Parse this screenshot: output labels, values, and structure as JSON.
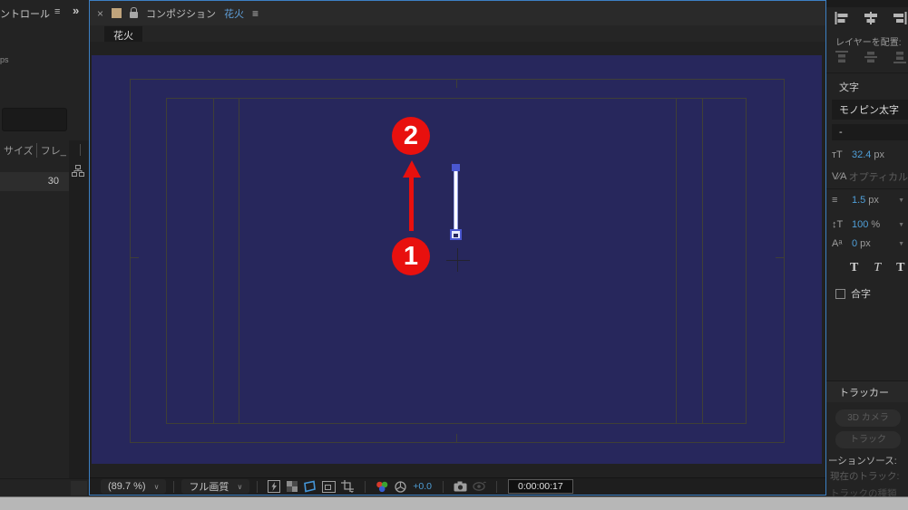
{
  "colors": {
    "accent_blue": "#3c80c4",
    "value_blue": "#4f9fd8",
    "comp_background": "#27275c",
    "annotation_red": "#e8100e",
    "panel_background": "#232323"
  },
  "left_panel": {
    "tab_label": "ントロール",
    "panel_menu_icon": "≡",
    "expand_icon": "»",
    "info_text": "ps",
    "table": {
      "columns": [
        "サイズ",
        "フレ_"
      ],
      "row_value": "30"
    }
  },
  "comp_panel": {
    "close_label": "×",
    "panel_title": "コンポジション",
    "comp_name": "花火",
    "panel_menu_icon": "≡",
    "tab_label": "花火",
    "annotations": {
      "step_1": "1",
      "step_2": "2"
    },
    "toolbar": {
      "zoom_value": "(89.7 %)",
      "zoom_chevron": "∨",
      "quality_value": "フル画質",
      "quality_chevron": "∨",
      "exposure_value": "+0.0",
      "timecode": "0:00:00:17"
    }
  },
  "right_panel": {
    "align": {
      "label": "レイヤーを配置:"
    },
    "character": {
      "header": "文字",
      "font_family": "モノピン太字",
      "font_style": "-",
      "font_size": {
        "icon": "ᴛT",
        "value": "32.4",
        "unit": "px"
      },
      "kerning": {
        "icon": "V⁄A",
        "value": "オプティカル"
      },
      "leading": {
        "icon": "≡",
        "value": "1.5",
        "unit": "px",
        "arrow": "▼"
      },
      "vertical_scale": {
        "icon": "↕T",
        "value": "100",
        "unit": "%",
        "arrow": "▼"
      },
      "baseline_shift": {
        "icon": "Aᵃ",
        "value": "0",
        "unit": "px",
        "arrow": "▼"
      },
      "faux": [
        "T",
        "T",
        "T"
      ],
      "ligature_label": "合字"
    },
    "tracker": {
      "header": "トラッカー",
      "button_3d_camera": "3D カメラ",
      "button_track": "トラック",
      "motion_source_label": "ーションソース:",
      "current_track_label": "現在のトラック:",
      "track_type_label": "トラックの種類"
    }
  }
}
